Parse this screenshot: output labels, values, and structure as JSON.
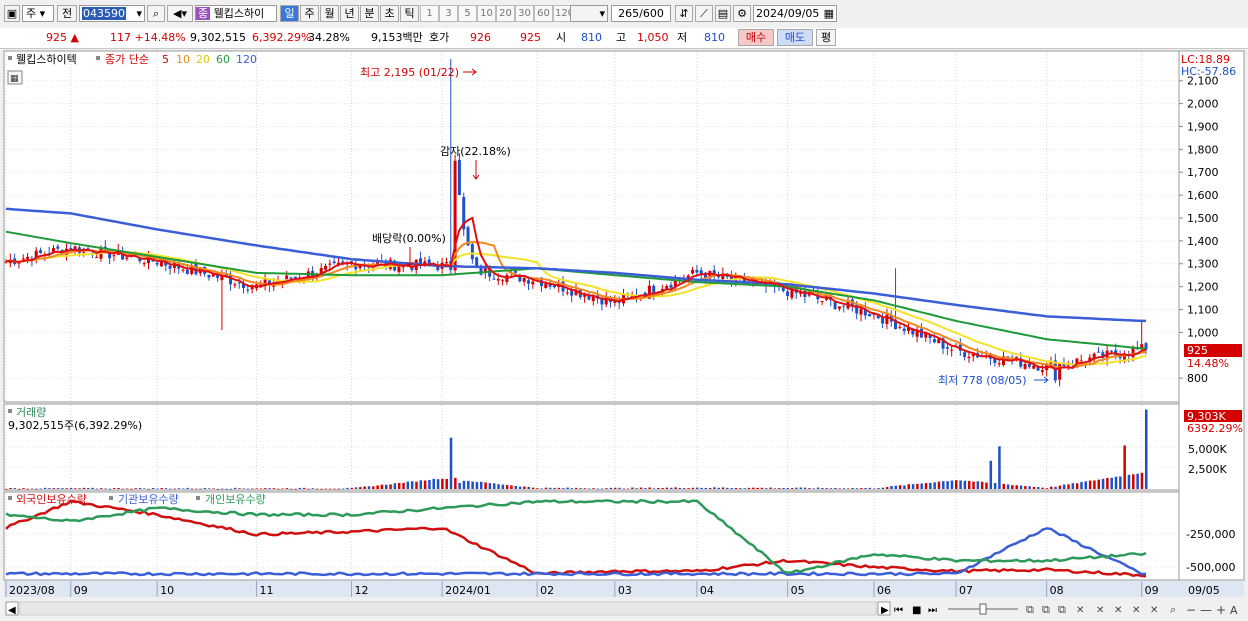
{
  "toolbar": {
    "period_unit": "주",
    "prev_label": "전",
    "code": "043590",
    "stock_name": "웰킵스하이",
    "stock_badge": "종",
    "period_tabs": [
      "일",
      "주",
      "월",
      "년",
      "분",
      "초",
      "틱"
    ],
    "active_tab": "일",
    "minute_values": [
      "1",
      "3",
      "5",
      "10",
      "20",
      "30",
      "60",
      "120"
    ],
    "range_count": "265",
    "range_max": "/600",
    "date": "2024/09/05"
  },
  "quote": {
    "price": "925",
    "change": "117",
    "change_pct": "+14.48%",
    "volume": "9,302,515",
    "volume_ratio": "6,392.29%",
    "turnover": "34.28%",
    "amount": "9,153백만",
    "bid_label": "호가",
    "bid": "926",
    "ask": "925",
    "open_label": "시",
    "open": "810",
    "high_label": "고",
    "high": "1,050",
    "low_label": "저",
    "low": "810",
    "buy_label": "매수",
    "sell_label": "매도",
    "eval_label": "평"
  },
  "legend": {
    "name": "웰킵스하이텍",
    "ma_label": "종가 단순",
    "ma_periods": [
      "5",
      "10",
      "20",
      "60",
      "120"
    ],
    "volume_title": "거래량",
    "volume_value": "9,302,515주(6,392.29%)",
    "holdings": [
      "외국인보유수량",
      "기관보유수량",
      "개인보유수량"
    ]
  },
  "annotations": {
    "high": "최고 2,195 (01/22)",
    "low": "최저 778 (08/05)",
    "capital_reduction": "감자(22.18%)",
    "dividend": "배당락(0.00%)",
    "lc": "LC:18.89",
    "hc": "HC:-57.86",
    "price_tag": "925",
    "pct_tag": "14.48%",
    "vol_tag": "9,303K",
    "vol_pct_tag": "6392.29%"
  },
  "colors": {
    "up": "#d40000",
    "down": "#1e50c8",
    "ma5": "#e11010",
    "ma10": "#f08a1e",
    "ma20": "#f2e22a",
    "ma60": "#1f9a3a",
    "ma120": "#3a5ed8",
    "foreign": "#d01010",
    "institution": "#3a5ed8",
    "individual": "#2e9a5a"
  },
  "chart_data": [
    {
      "type": "line",
      "title": "웰킵스하이텍",
      "x": [
        "2023/08",
        "09",
        "10",
        "11",
        "12",
        "2024/01",
        "02",
        "03",
        "04",
        "05",
        "06",
        "07",
        "08",
        "09"
      ],
      "series": [
        {
          "name": "종가",
          "values": [
            1310,
            1370,
            1310,
            1200,
            1300,
            1290,
            1230,
            1130,
            1260,
            1180,
            1080,
            920,
            850,
            925
          ]
        },
        {
          "name": "120",
          "values": [
            1540,
            1520,
            1450,
            1380,
            1320,
            1290,
            1280,
            1260,
            1230,
            1210,
            1170,
            1120,
            1070,
            1050
          ]
        },
        {
          "name": "60",
          "values": [
            1440,
            1390,
            1330,
            1260,
            1250,
            1250,
            1280,
            1250,
            1220,
            1200,
            1140,
            1050,
            970,
            930
          ]
        }
      ],
      "ylim": [
        700,
        2230
      ],
      "yticks": [
        800,
        1000,
        1100,
        1200,
        1300,
        1400,
        1500,
        1600,
        1700,
        1800,
        1900,
        2000,
        2100
      ],
      "high": {
        "date": "01/22",
        "value": 2195
      },
      "low": {
        "date": "08/05",
        "value": 778
      }
    },
    {
      "type": "bar",
      "title": "거래량",
      "x": [
        "2023/08",
        "09",
        "10",
        "11",
        "12",
        "2024/01",
        "02",
        "03",
        "04",
        "05",
        "06",
        "07",
        "08",
        "09"
      ],
      "values": [
        0.1,
        0.1,
        0.1,
        0.1,
        0.1,
        6.0,
        0.3,
        0.2,
        0.5,
        0.3,
        0.2,
        5.0,
        0.4,
        9.3
      ],
      "unit": "M",
      "yticks": [
        "2,500K",
        "5,000K"
      ]
    },
    {
      "type": "line",
      "title": "외국인보유수량 · 기관보유수량 · 개인보유수량",
      "x": [
        "2023/08",
        "09",
        "10",
        "11",
        "12",
        "2024/01",
        "02",
        "03",
        "04",
        "05",
        "06",
        "07",
        "08",
        "09"
      ],
      "series": [
        {
          "name": "외국인보유수량",
          "values": [
            -250000,
            -50000,
            -150000,
            -300000,
            -280000,
            -250000,
            -600000,
            -580000,
            -580000,
            -500000,
            -550000,
            -580000,
            -570000,
            -610000
          ]
        },
        {
          "name": "기관보유수량",
          "values": [
            -600000,
            -600000,
            -600000,
            -600000,
            -600000,
            -600000,
            -600000,
            -600000,
            -600000,
            -600000,
            -600000,
            -600000,
            -250000,
            -600000
          ]
        },
        {
          "name": "개인보유수량",
          "values": [
            -150000,
            -200000,
            -100000,
            -150000,
            -150000,
            -100000,
            -50000,
            -50000,
            -50000,
            -600000,
            -450000,
            -500000,
            -500000,
            -450000
          ]
        }
      ],
      "yticks": [
        "-250,000",
        "-500,000"
      ]
    }
  ],
  "time_axis": {
    "labels": [
      "2023/08",
      "09",
      "10",
      "11",
      "12",
      "2024/01",
      "02",
      "03",
      "04",
      "05",
      "06",
      "07",
      "08",
      "09"
    ],
    "end_label": "09/05"
  }
}
